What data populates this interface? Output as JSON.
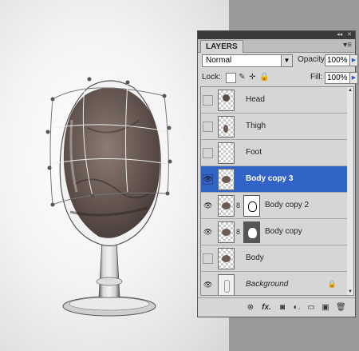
{
  "panel": {
    "title": "LAYERS",
    "titlebar_icons": [
      "collapse-icon",
      "close-icon"
    ],
    "menu_icon": "panel-menu-icon"
  },
  "blend_mode": "Normal",
  "opacity_label": "Opacity:",
  "opacity_value": "100%",
  "lock_label": "Lock:",
  "fill_label": "Fill:",
  "fill_value": "100%",
  "layers": [
    {
      "name": "Head",
      "visible": false,
      "selected": false,
      "mask": null
    },
    {
      "name": "Thigh",
      "visible": false,
      "selected": false,
      "mask": null
    },
    {
      "name": "Foot",
      "visible": false,
      "selected": false,
      "mask": null
    },
    {
      "name": "Body copy 3",
      "visible": true,
      "selected": true,
      "mask": null
    },
    {
      "name": "Body copy 2",
      "visible": true,
      "selected": false,
      "mask": "light"
    },
    {
      "name": "Body copy",
      "visible": true,
      "selected": false,
      "mask": "dark"
    },
    {
      "name": "Body",
      "visible": false,
      "selected": false,
      "mask": null
    },
    {
      "name": "Background",
      "visible": true,
      "selected": false,
      "mask": null,
      "locked": true
    }
  ],
  "footer_icons": [
    "link-icon",
    "fx-icon",
    "add-mask-icon",
    "adjustment-icon",
    "group-folder-icon",
    "new-layer-icon",
    "trash-icon"
  ],
  "footer_glyphs": [
    "⊗",
    "fx.",
    "◙",
    "◐.",
    "▭",
    "▣",
    "🗑"
  ],
  "colors": {
    "selected_row": "#3264c8",
    "panel_bg": "#d6d6d6"
  }
}
